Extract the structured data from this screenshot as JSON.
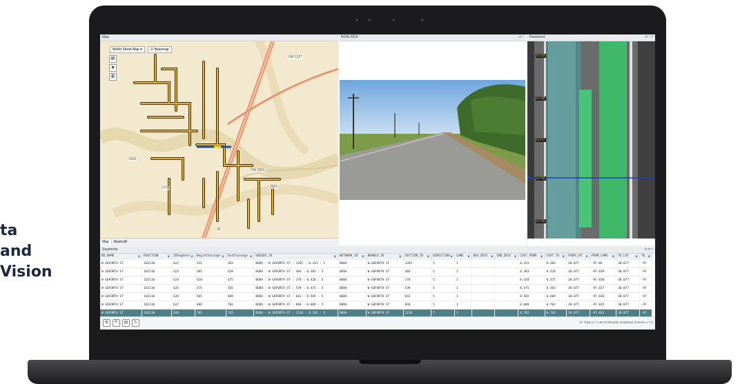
{
  "side_text": {
    "line1": "ta",
    "line2": "and",
    "line3": "Vision"
  },
  "map_panel": {
    "title": "Map",
    "basemap_select": "World Street Map",
    "basemap_checkbox": "Basemap",
    "tabs": [
      "Map",
      "RearLeft"
    ],
    "labels": [
      "FM 1327",
      "FM 2001",
      "FM 2001",
      "2001",
      "2770",
      "1626",
      "35"
    ]
  },
  "row_panel": {
    "title": "ROW 2020"
  },
  "pavement_panel": {
    "title": "Pavement",
    "chainages": [
      "0.715",
      "0.716",
      "0.717",
      "0.718",
      "0.719"
    ]
  },
  "segments": {
    "title": "Segments",
    "columns": [
      "RD_NAME",
      "RSECTION",
      "IDSegment",
      "BeginChainage",
      "EndChainage",
      "UNIQUE_ID",
      "NETWORK_ID",
      "BRANCH_ID",
      "SECTION_ID",
      "DIRECTION",
      "LANE",
      "BEG_DESC",
      "END_DESC",
      "CUST_FROM",
      "CUST_TO",
      "FROM_LAT",
      "FROM_LONG",
      "TO_LAT",
      "TO_"
    ],
    "rows": [
      [
        "W GOFORTH ST",
        "102110",
        "622",
        "332",
        "383",
        "BUDA : W GOFORTH ST : 1265 : 0.333 : 5",
        "BUDA",
        "W GOFORTH ST",
        "1265",
        "5",
        "1",
        "",
        "",
        "0.333",
        "0.383",
        "30.077",
        "-97.84",
        "30.077",
        "-97"
      ],
      [
        "W GOFORTH ST",
        "102110",
        "623",
        "383",
        "428",
        "BUDA : W GOFORTH ST : 484 : 0.383 : 5",
        "BUDA",
        "W GOFORTH ST",
        "484",
        "5",
        "1",
        "",
        "",
        "0.383",
        "0.428",
        "30.077",
        "-97.839",
        "30.077",
        "-97"
      ],
      [
        "W GOFORTH ST",
        "102110",
        "624",
        "428",
        "475",
        "BUDA : W GOFORTH ST : 178 : 0.428 : 5",
        "BUDA",
        "W GOFORTH ST",
        "178",
        "5",
        "1",
        "",
        "",
        "0.428",
        "0.475",
        "30.077",
        "-97.838",
        "30.077",
        "-97"
      ],
      [
        "W GOFORTH ST",
        "102110",
        "625",
        "475",
        "565",
        "BUDA : W GOFORTH ST : 539 : 0.475 : 5",
        "BUDA",
        "W GOFORTH ST",
        "539",
        "5",
        "1",
        "",
        "",
        "0.475",
        "0.565",
        "30.077",
        "-97.837",
        "30.077",
        "-97"
      ],
      [
        "W GOFORTH ST",
        "102110",
        "626",
        "565",
        "609",
        "BUDA : W GOFORTH ST : 642 : 0.565 : 5",
        "BUDA",
        "W GOFORTH ST",
        "642",
        "5",
        "1",
        "",
        "",
        "0.565",
        "0.609",
        "30.077",
        "-97.836",
        "30.077",
        "-97"
      ],
      [
        "W GOFORTH ST",
        "102110",
        "627",
        "609",
        "702",
        "BUDA : W GOFORTH ST : 694 : 0.609 : 5",
        "BUDA",
        "W GOFORTH ST",
        "694",
        "5",
        "1",
        "",
        "",
        "0.609",
        "0.702",
        "30.077",
        "-97.835",
        "30.077",
        "-97"
      ],
      [
        "W GOFORTH ST",
        "102110",
        "628",
        "702",
        "743",
        "BUDA : W GOFORTH ST : 1216 : 0.702 : 5",
        "BUDA",
        "W GOFORTH ST",
        "1216",
        "5",
        "1",
        "",
        "",
        "0.702",
        "0.743",
        "30.077",
        "-97.833",
        "30.077",
        "-97"
      ]
    ],
    "selected_row": 6,
    "status": "87 Total  s7 | 1:80 ProRender    Database Scheme v 7.5"
  },
  "colors": {
    "accent": "#3b8fc4",
    "selected_row": "#4f7f86",
    "road": "#e8b321"
  }
}
